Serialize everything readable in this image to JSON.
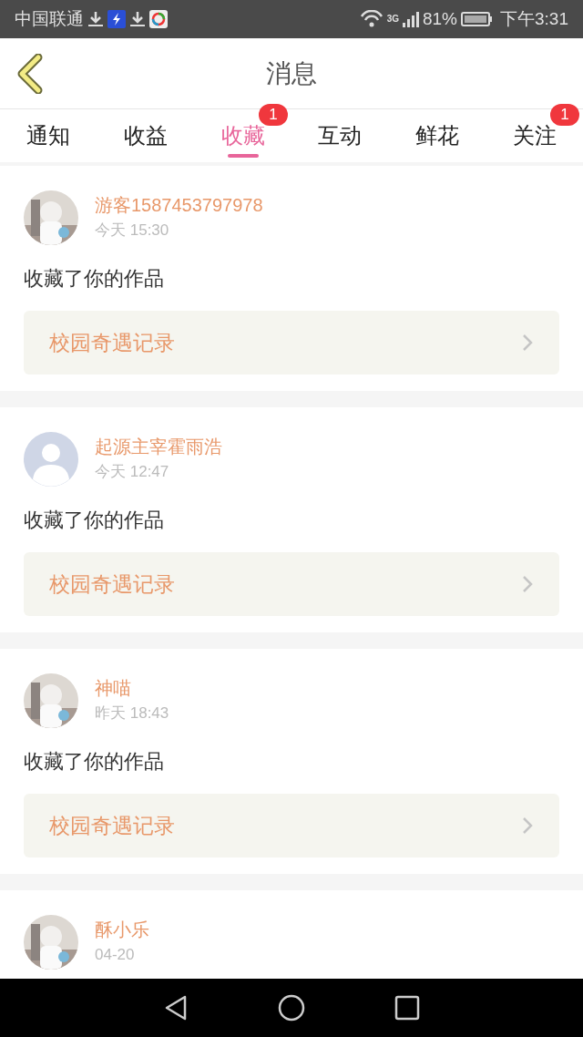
{
  "status_bar": {
    "carrier": "中国联通",
    "network": "3G",
    "battery": "81%",
    "time": "下午3:31"
  },
  "header": {
    "title": "消息"
  },
  "tabs": [
    {
      "label": "通知",
      "selected": false
    },
    {
      "label": "收益",
      "selected": false
    },
    {
      "label": "收藏",
      "selected": true,
      "badge": "1"
    },
    {
      "label": "互动",
      "selected": false
    },
    {
      "label": "鲜花",
      "selected": false
    },
    {
      "label": "关注",
      "selected": false,
      "badge": "1"
    }
  ],
  "messages": [
    {
      "default_avatar": false,
      "user": "游客1587453797978",
      "time": "今天 15:30",
      "text": "收藏了你的作品",
      "work": "校园奇遇记录"
    },
    {
      "default_avatar": true,
      "user": "起源主宰霍雨浩",
      "time": "今天 12:47",
      "text": "收藏了你的作品",
      "work": "校园奇遇记录"
    },
    {
      "default_avatar": false,
      "user": "神喵",
      "time": "昨天 18:43",
      "text": "收藏了你的作品",
      "work": "校园奇遇记录"
    },
    {
      "default_avatar": false,
      "user": "酥小乐",
      "time": "04-20"
    }
  ]
}
